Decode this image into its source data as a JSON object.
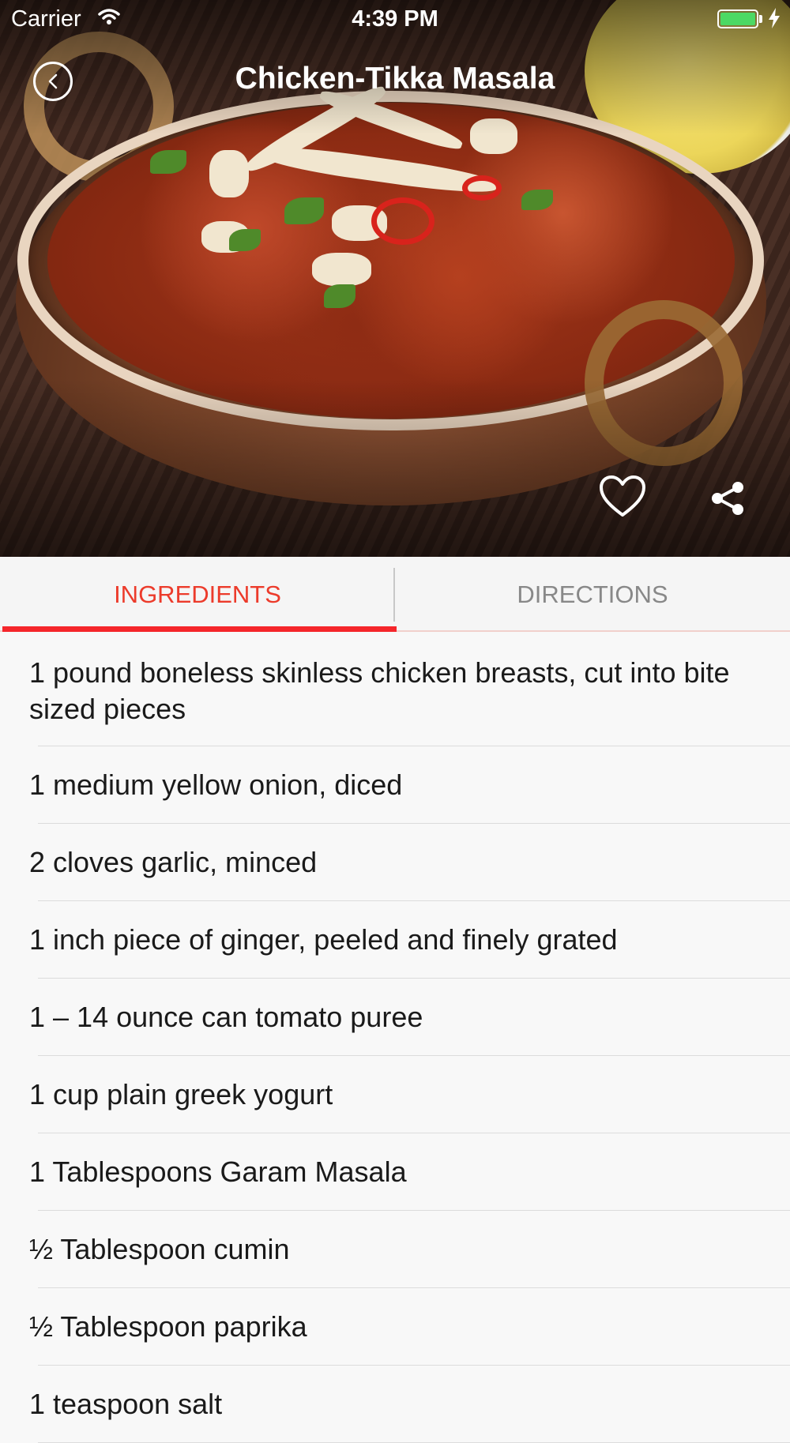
{
  "status_bar": {
    "carrier": "Carrier",
    "time": "4:39 PM",
    "battery_color": "#4cd964"
  },
  "header": {
    "title": "Chicken-Tikka Masala",
    "back_icon": "chevron-left-icon",
    "favorite_icon": "heart-outline-icon",
    "share_icon": "share-icon"
  },
  "tabs": {
    "items": [
      {
        "label": "INGREDIENTS",
        "active": true
      },
      {
        "label": "DIRECTIONS",
        "active": false
      }
    ],
    "accent_color": "#f5262b"
  },
  "ingredients": [
    "1 pound boneless skinless chicken breasts, cut into bite sized pieces",
    "1 medium yellow onion, diced",
    "2 cloves garlic, minced",
    "1 inch piece of ginger, peeled and finely grated",
    "1 – 14 ounce can tomato puree",
    "1 cup plain greek yogurt",
    "1 Tablespoons Garam Masala",
    "½ Tablespoon cumin",
    "½ Tablespoon paprika",
    "1 teaspoon salt"
  ]
}
